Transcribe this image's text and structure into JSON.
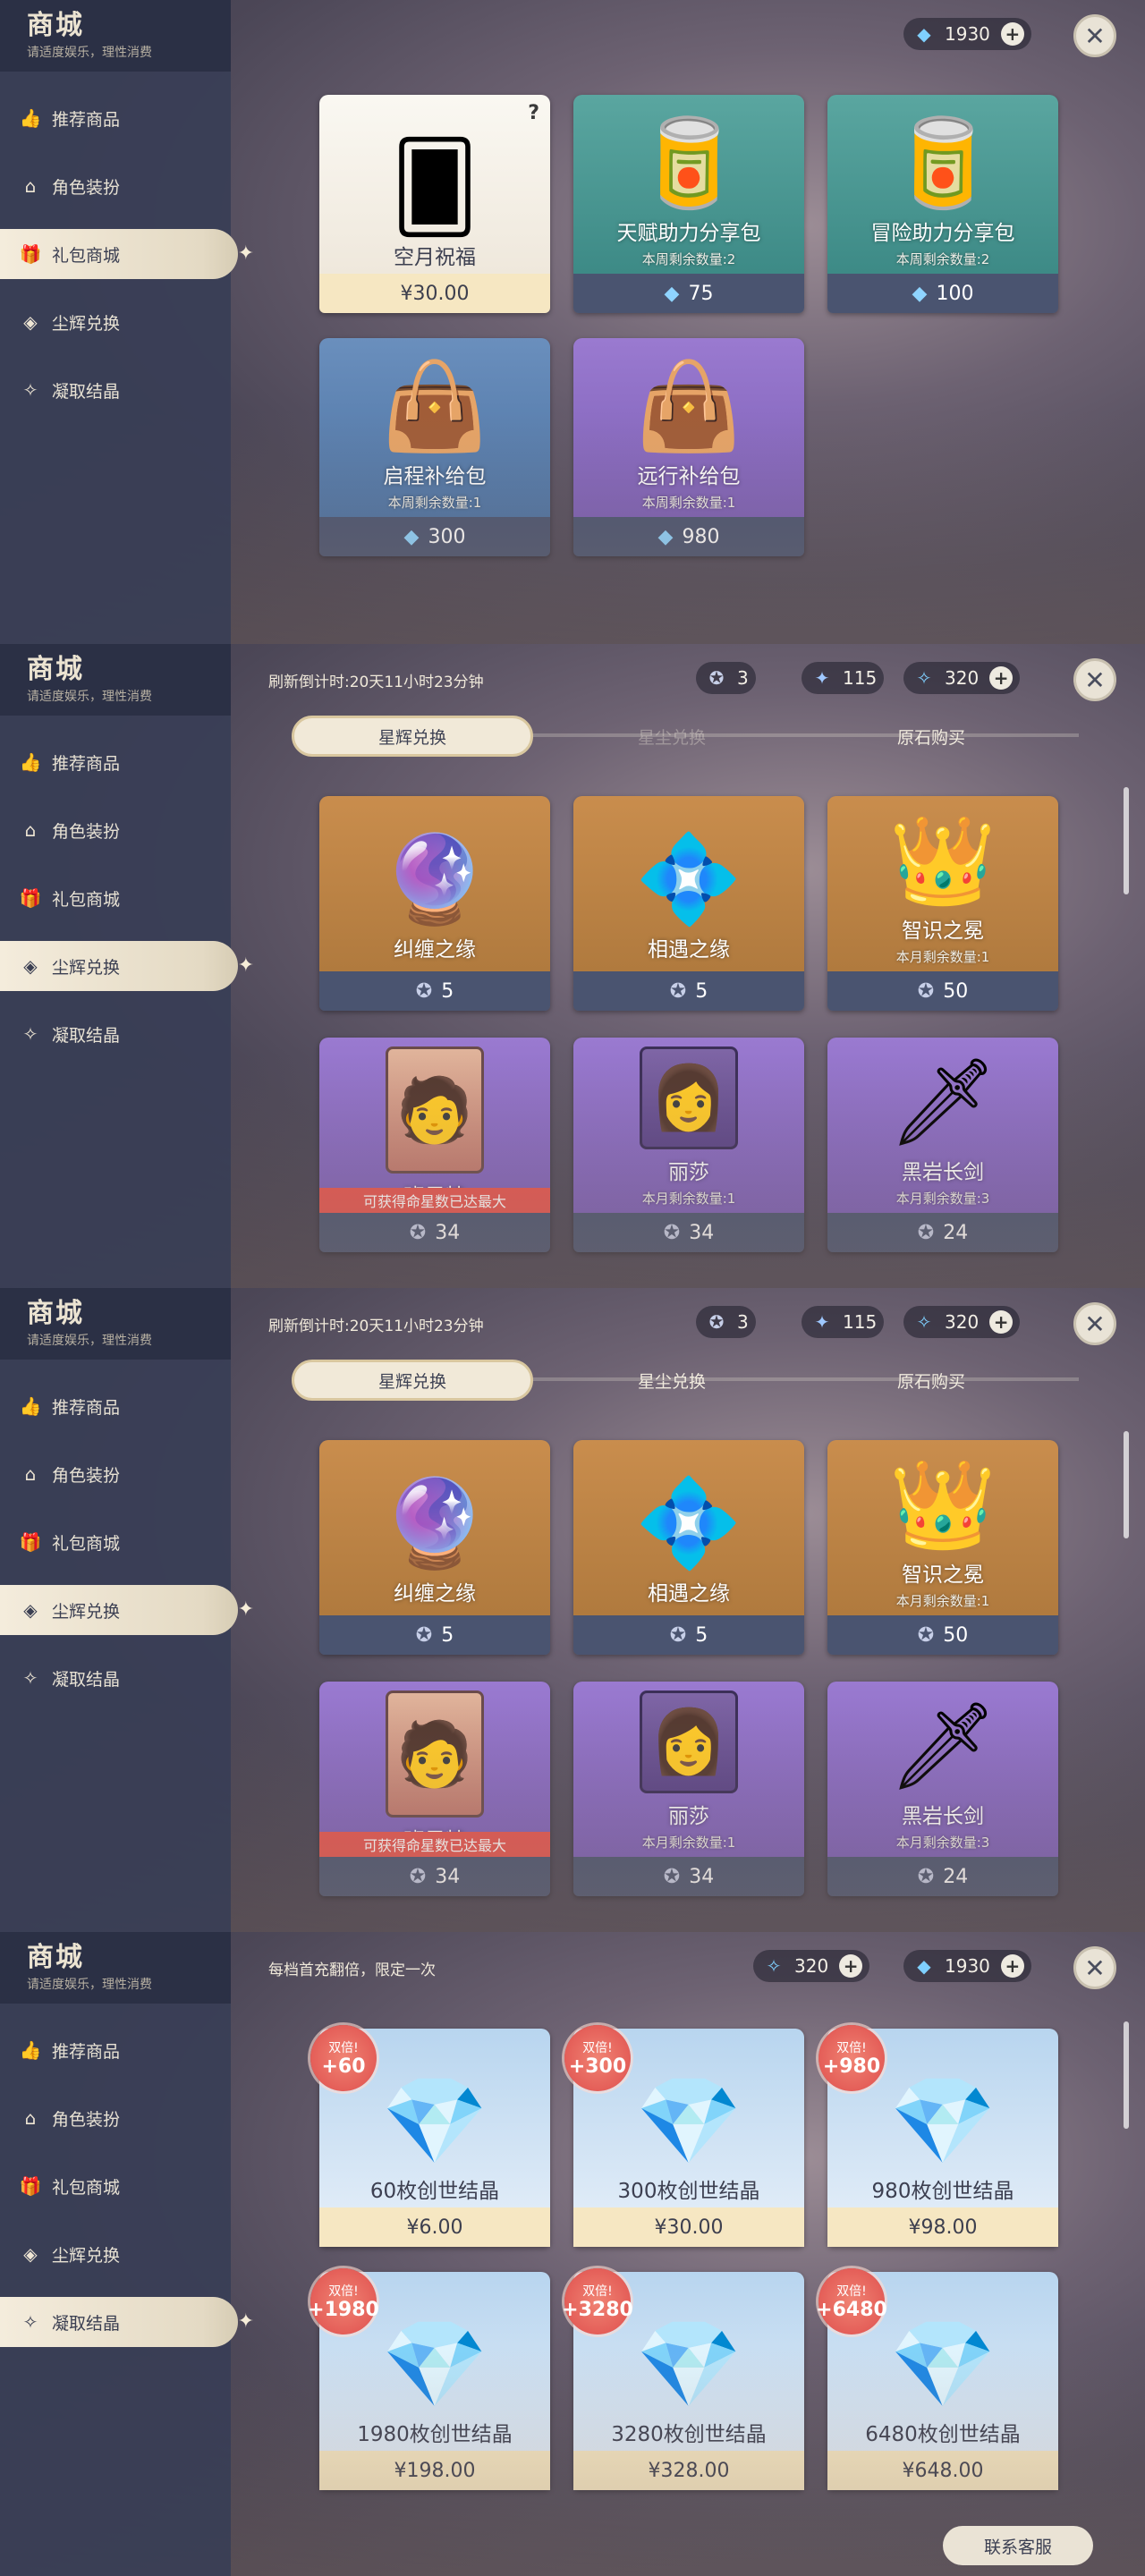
{
  "shop": {
    "title": "商城",
    "subtitle": "请适度娱乐，理性消费"
  },
  "nav": [
    "推荐商品",
    "角色装扮",
    "礼包商城",
    "尘辉兑换",
    "凝取结晶"
  ],
  "screen1": {
    "currency": "1930",
    "cards": [
      {
        "name": "空月祝福",
        "remain": "",
        "price": "¥30.00"
      },
      {
        "name": "天赋助力分享包",
        "remain": "本周剩余数量:2",
        "price": "75"
      },
      {
        "name": "冒险助力分享包",
        "remain": "本周剩余数量:2",
        "price": "100"
      },
      {
        "name": "启程补给包",
        "remain": "本周剩余数量:1",
        "price": "300"
      },
      {
        "name": "远行补给包",
        "remain": "本周剩余数量:1",
        "price": "980"
      }
    ]
  },
  "stardust": {
    "countdown": "刷新倒计时:20天11小时23分钟",
    "currencies": [
      "3",
      "115",
      "320"
    ],
    "tabs": [
      "星辉兑换",
      "星尘兑换",
      "原石购买"
    ],
    "cards": [
      {
        "name": "纠缠之缘",
        "remain": "",
        "price": "5"
      },
      {
        "name": "相遇之缘",
        "remain": "",
        "price": "5"
      },
      {
        "name": "智识之冕",
        "remain": "本月剩余数量:1",
        "price": "50"
      },
      {
        "name": "班尼特",
        "remain": "",
        "banner": "可获得命星数已达最大",
        "price": "34"
      },
      {
        "name": "丽莎",
        "remain": "本月剩余数量:1",
        "price": "34"
      },
      {
        "name": "黑岩长剑",
        "remain": "本月剩余数量:3",
        "price": "24"
      }
    ]
  },
  "crystal": {
    "promo": "每档首充翻倍，限定一次",
    "currencies": [
      "320",
      "1930"
    ],
    "double_label": "双倍!",
    "cards": [
      {
        "bonus": "+60",
        "name": "60枚创世结晶",
        "price": "¥6.00"
      },
      {
        "bonus": "+300",
        "name": "300枚创世结晶",
        "price": "¥30.00"
      },
      {
        "bonus": "+980",
        "name": "980枚创世结晶",
        "price": "¥98.00"
      },
      {
        "bonus": "+1980",
        "name": "1980枚创世结晶",
        "price": "¥198.00"
      },
      {
        "bonus": "+3280",
        "name": "3280枚创世结晶",
        "price": "¥328.00"
      },
      {
        "bonus": "+6480",
        "name": "6480枚创世结晶",
        "price": "¥648.00"
      }
    ],
    "support": "联系客服"
  }
}
